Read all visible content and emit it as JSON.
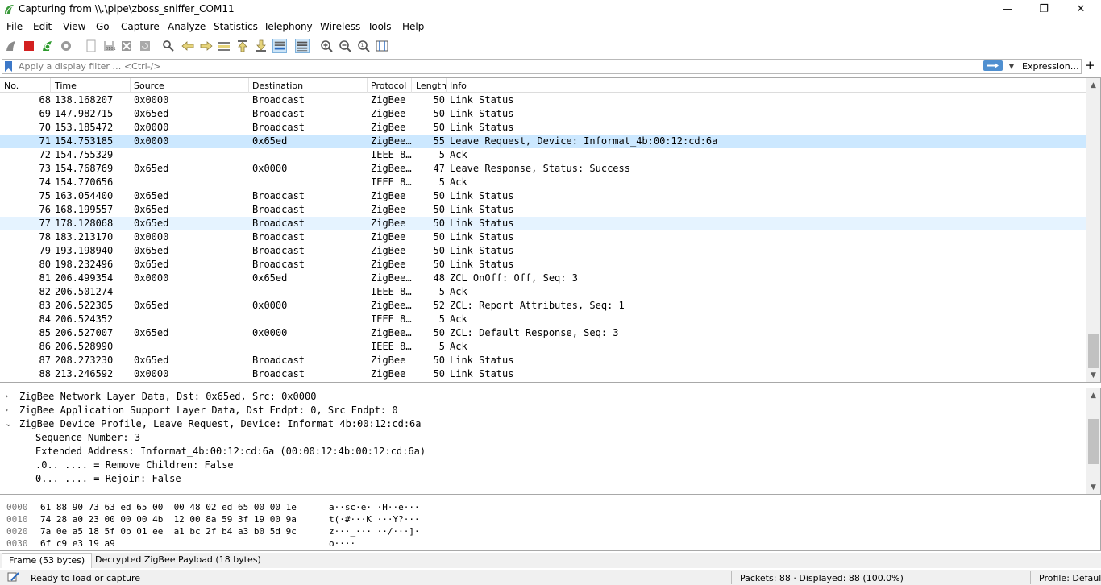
{
  "window": {
    "title": "Capturing from \\\\.\\pipe\\zboss_sniffer_COM11",
    "minimize": "—",
    "restore": "❐",
    "close": "✕"
  },
  "menu": [
    "File",
    "Edit",
    "View",
    "Go",
    "Capture",
    "Analyze",
    "Statistics",
    "Telephony",
    "Wireless",
    "Tools",
    "Help"
  ],
  "toolbar": {
    "icons": [
      "shark-fin-start-icon",
      "stop-capture-icon",
      "restart-capture-icon",
      "capture-options-icon",
      "open-file-icon",
      "save-file-icon",
      "close-file-icon",
      "reload-file-icon",
      "find-packet-icon",
      "go-back-icon",
      "go-forward-icon",
      "go-to-packet-icon",
      "first-packet-icon",
      "last-packet-icon",
      "autoscroll-icon",
      "colorize-icon",
      "zoom-in-icon",
      "zoom-out-icon",
      "zoom-normal-icon",
      "resize-columns-icon"
    ]
  },
  "filter": {
    "placeholder": "Apply a display filter … <Ctrl-/>",
    "expression_label": "Expression…",
    "plus_label": "+"
  },
  "packet_list": {
    "columns": [
      "No.",
      "Time",
      "Source",
      "Destination",
      "Protocol",
      "Length",
      "Info"
    ],
    "rows": [
      {
        "no": "68",
        "time": "138.168207",
        "src": "0x0000",
        "dst": "Broadcast",
        "proto": "ZigBee",
        "len": "50",
        "info": "Link Status"
      },
      {
        "no": "69",
        "time": "147.982715",
        "src": "0x65ed",
        "dst": "Broadcast",
        "proto": "ZigBee",
        "len": "50",
        "info": "Link Status"
      },
      {
        "no": "70",
        "time": "153.185472",
        "src": "0x0000",
        "dst": "Broadcast",
        "proto": "ZigBee",
        "len": "50",
        "info": "Link Status"
      },
      {
        "no": "71",
        "time": "154.753185",
        "src": "0x0000",
        "dst": "0x65ed",
        "proto": "ZigBee…",
        "len": "55",
        "info": "Leave Request, Device: Informat_4b:00:12:cd:6a"
      },
      {
        "no": "72",
        "time": "154.755329",
        "src": "",
        "dst": "",
        "proto": "IEEE 8…",
        "len": "5",
        "info": "Ack"
      },
      {
        "no": "73",
        "time": "154.768769",
        "src": "0x65ed",
        "dst": "0x0000",
        "proto": "ZigBee…",
        "len": "47",
        "info": "Leave Response, Status: Success"
      },
      {
        "no": "74",
        "time": "154.770656",
        "src": "",
        "dst": "",
        "proto": "IEEE 8…",
        "len": "5",
        "info": "Ack"
      },
      {
        "no": "75",
        "time": "163.054400",
        "src": "0x65ed",
        "dst": "Broadcast",
        "proto": "ZigBee",
        "len": "50",
        "info": "Link Status"
      },
      {
        "no": "76",
        "time": "168.199557",
        "src": "0x65ed",
        "dst": "Broadcast",
        "proto": "ZigBee",
        "len": "50",
        "info": "Link Status"
      },
      {
        "no": "77",
        "time": "178.128068",
        "src": "0x65ed",
        "dst": "Broadcast",
        "proto": "ZigBee",
        "len": "50",
        "info": "Link Status"
      },
      {
        "no": "78",
        "time": "183.213170",
        "src": "0x0000",
        "dst": "Broadcast",
        "proto": "ZigBee",
        "len": "50",
        "info": "Link Status"
      },
      {
        "no": "79",
        "time": "193.198940",
        "src": "0x65ed",
        "dst": "Broadcast",
        "proto": "ZigBee",
        "len": "50",
        "info": "Link Status"
      },
      {
        "no": "80",
        "time": "198.232496",
        "src": "0x65ed",
        "dst": "Broadcast",
        "proto": "ZigBee",
        "len": "50",
        "info": "Link Status"
      },
      {
        "no": "81",
        "time": "206.499354",
        "src": "0x0000",
        "dst": "0x65ed",
        "proto": "ZigBee…",
        "len": "48",
        "info": "ZCL OnOff: Off, Seq: 3"
      },
      {
        "no": "82",
        "time": "206.501274",
        "src": "",
        "dst": "",
        "proto": "IEEE 8…",
        "len": "5",
        "info": "Ack"
      },
      {
        "no": "83",
        "time": "206.522305",
        "src": "0x65ed",
        "dst": "0x0000",
        "proto": "ZigBee…",
        "len": "52",
        "info": "ZCL: Report Attributes, Seq: 1"
      },
      {
        "no": "84",
        "time": "206.524352",
        "src": "",
        "dst": "",
        "proto": "IEEE 8…",
        "len": "5",
        "info": "Ack"
      },
      {
        "no": "85",
        "time": "206.527007",
        "src": "0x65ed",
        "dst": "0x0000",
        "proto": "ZigBee…",
        "len": "50",
        "info": "ZCL: Default Response, Seq: 3"
      },
      {
        "no": "86",
        "time": "206.528990",
        "src": "",
        "dst": "",
        "proto": "IEEE 8…",
        "len": "5",
        "info": "Ack"
      },
      {
        "no": "87",
        "time": "208.273230",
        "src": "0x65ed",
        "dst": "Broadcast",
        "proto": "ZigBee",
        "len": "50",
        "info": "Link Status"
      },
      {
        "no": "88",
        "time": "213.246592",
        "src": "0x0000",
        "dst": "Broadcast",
        "proto": "ZigBee",
        "len": "50",
        "info": "Link Status"
      }
    ],
    "selected_no": "71",
    "hover_no": "77"
  },
  "details": [
    {
      "expanded": false,
      "indent": 0,
      "text": "ZigBee Network Layer Data, Dst: 0x65ed, Src: 0x0000"
    },
    {
      "expanded": false,
      "indent": 0,
      "text": "ZigBee Application Support Layer Data, Dst Endpt: 0, Src Endpt: 0"
    },
    {
      "expanded": true,
      "indent": 0,
      "text": "ZigBee Device Profile, Leave Request, Device: Informat_4b:00:12:cd:6a"
    },
    {
      "expanded": null,
      "indent": 1,
      "text": "Sequence Number: 3"
    },
    {
      "expanded": null,
      "indent": 1,
      "text": "Extended Address: Informat_4b:00:12:cd:6a (00:00:12:4b:00:12:cd:6a)"
    },
    {
      "expanded": null,
      "indent": 1,
      "text": ".0.. .... = Remove Children: False"
    },
    {
      "expanded": null,
      "indent": 1,
      "text": "0... .... = Rejoin: False"
    }
  ],
  "bytes": [
    {
      "off": "0000",
      "hex": "61 88 90 73 63 ed 65 00  00 48 02 ed 65 00 00 1e",
      "ascii": "a··sc·e· ·H··e···"
    },
    {
      "off": "0010",
      "hex": "74 28 a0 23 00 00 00 4b  12 00 8a 59 3f 19 00 9a",
      "ascii": "t(·#···K ···Y?···"
    },
    {
      "off": "0020",
      "hex": "7a 0e a5 18 5f 0b 01 ee  a1 bc 2f b4 a3 b0 5d 9c",
      "ascii": "z···_··· ··/···]·"
    },
    {
      "off": "0030",
      "hex": "6f c9 e3 19 a9",
      "ascii": "o····"
    }
  ],
  "bottom_tabs": [
    "Frame (53 bytes)",
    "Decrypted ZigBee Payload (18 bytes)"
  ],
  "status": {
    "ready": "Ready to load or capture",
    "packets": "Packets: 88 · Displayed: 88 (100.0%)",
    "profile": "Profile: Default"
  },
  "colors": {
    "selected_row": "#cce8ff",
    "hover_row": "#e5f3ff",
    "accent": "#4f8fd0"
  }
}
